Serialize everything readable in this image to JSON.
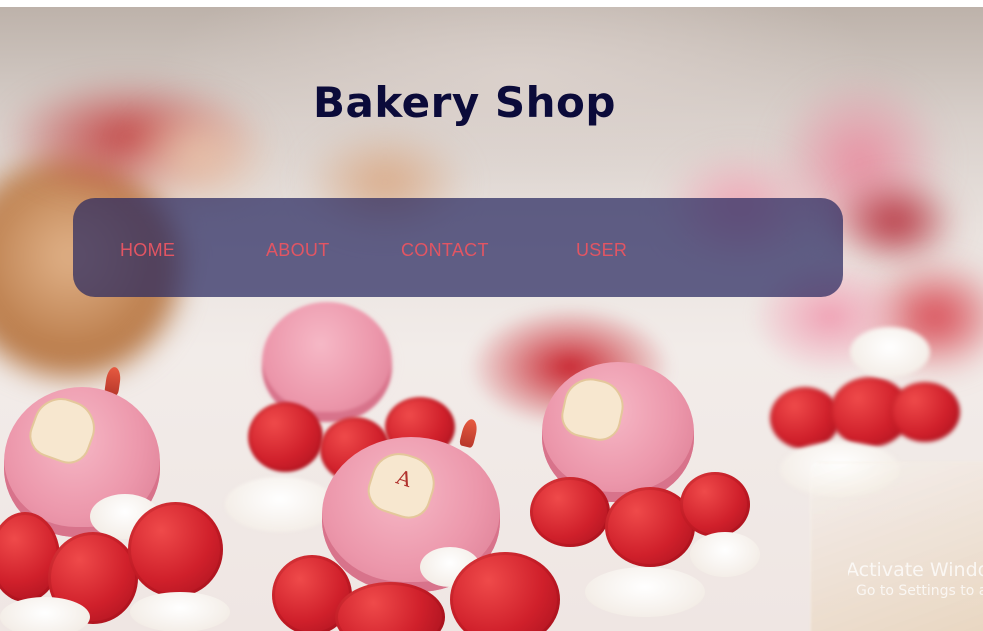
{
  "site": {
    "title": "Bakery Shop"
  },
  "nav": {
    "items": [
      {
        "label": "HOME"
      },
      {
        "label": "ABOUT"
      },
      {
        "label": "CONTACT"
      },
      {
        "label": "USER"
      }
    ]
  },
  "watermark": {
    "title": "Activate Windows",
    "subtitle": "Go to Settings to activate Windows."
  },
  "colors": {
    "title_text": "#0b0b3a",
    "nav_background": "#28285f",
    "nav_link": "#e25563"
  },
  "background": {
    "subject": "raspberry macaron pastries"
  }
}
